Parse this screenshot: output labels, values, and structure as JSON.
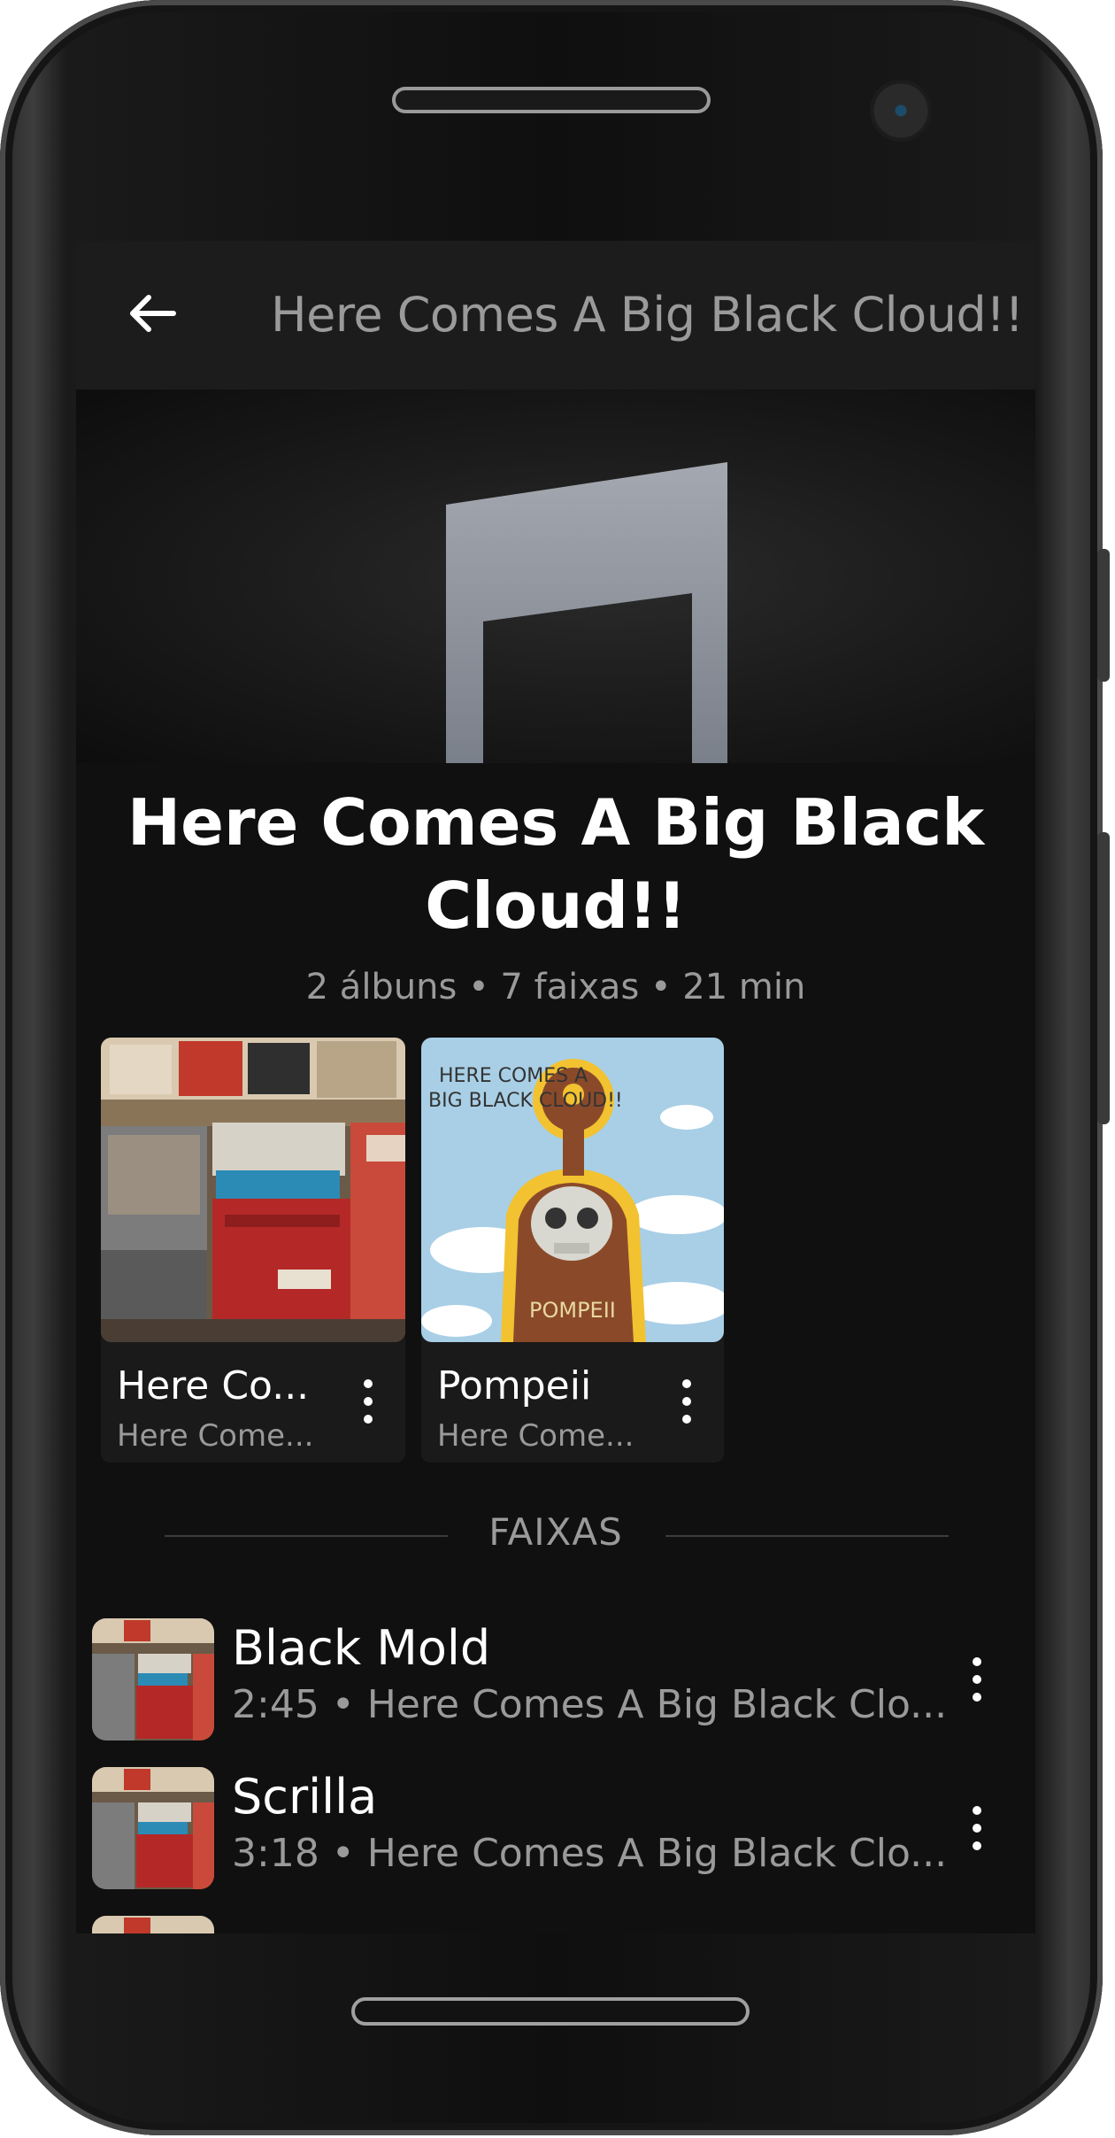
{
  "app_bar": {
    "title": "Here Comes A Big Black Cloud!!",
    "back_icon": "arrow-left-icon"
  },
  "artist": {
    "name": "Here Comes A Big Black Cloud!!",
    "stats": "2 álbuns • 7 faixas • 21 min"
  },
  "albums": [
    {
      "title": "Here Co...",
      "artist": "Here Come..."
    },
    {
      "title": "Pompeii",
      "artist": "Here Come..."
    }
  ],
  "section": {
    "label": "FAIXAS"
  },
  "tracks": [
    {
      "title": "Black Mold",
      "subtitle": "2:45 • Here Comes A Big Black Clo..."
    },
    {
      "title": "Scrilla",
      "subtitle": "3:18 • Here Comes A Big Black Clo..."
    },
    {
      "title": "",
      "subtitle": ""
    }
  ],
  "colors": {
    "background": "#101010",
    "app_bar": "#1c1c1c",
    "primary_text": "#ffffff",
    "secondary_text": "#9a9a9a"
  }
}
